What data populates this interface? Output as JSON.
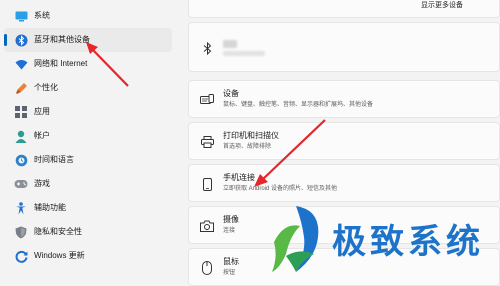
{
  "sidebar": {
    "items": [
      {
        "label": "系统",
        "icon": "monitor-icon",
        "active": false
      },
      {
        "label": "蓝牙和其他设备",
        "icon": "bluetooth-icon",
        "active": true
      },
      {
        "label": "网络和 Internet",
        "icon": "wifi-icon",
        "active": false
      },
      {
        "label": "个性化",
        "icon": "paintbrush-icon",
        "active": false
      },
      {
        "label": "应用",
        "icon": "apps-icon",
        "active": false
      },
      {
        "label": "帐户",
        "icon": "person-icon",
        "active": false
      },
      {
        "label": "时间和语言",
        "icon": "globe-clock-icon",
        "active": false
      },
      {
        "label": "游戏",
        "icon": "gamepad-icon",
        "active": false
      },
      {
        "label": "辅助功能",
        "icon": "accessibility-icon",
        "active": false
      },
      {
        "label": "隐私和安全性",
        "icon": "shield-icon",
        "active": false
      },
      {
        "label": "Windows 更新",
        "icon": "update-icon",
        "active": false
      }
    ]
  },
  "main": {
    "show_more": "显示更多设备",
    "cards": [
      {
        "title": "设备",
        "subtitle": "鼠标、键盘、触控笔、音频、显示器和扩展坞、其他设备",
        "icon": "devices-icon"
      },
      {
        "title": "打印机和扫描仪",
        "subtitle": "首选项、故障排除",
        "icon": "printer-icon"
      },
      {
        "title": "手机连接",
        "subtitle": "立即获取 Android 设备的照片、短信及其他",
        "icon": "phone-icon"
      },
      {
        "title": "摄像",
        "subtitle": "连接",
        "icon": "camera-icon"
      },
      {
        "title": "鼠标",
        "subtitle": "按钮",
        "icon": "mouse-icon"
      }
    ]
  },
  "watermark": {
    "text": "极致系统",
    "icon": "dragon-logo-icon"
  },
  "colors": {
    "accent": "#0067c0",
    "arrow": "#e5262a",
    "watermark": "#1d73c9"
  }
}
